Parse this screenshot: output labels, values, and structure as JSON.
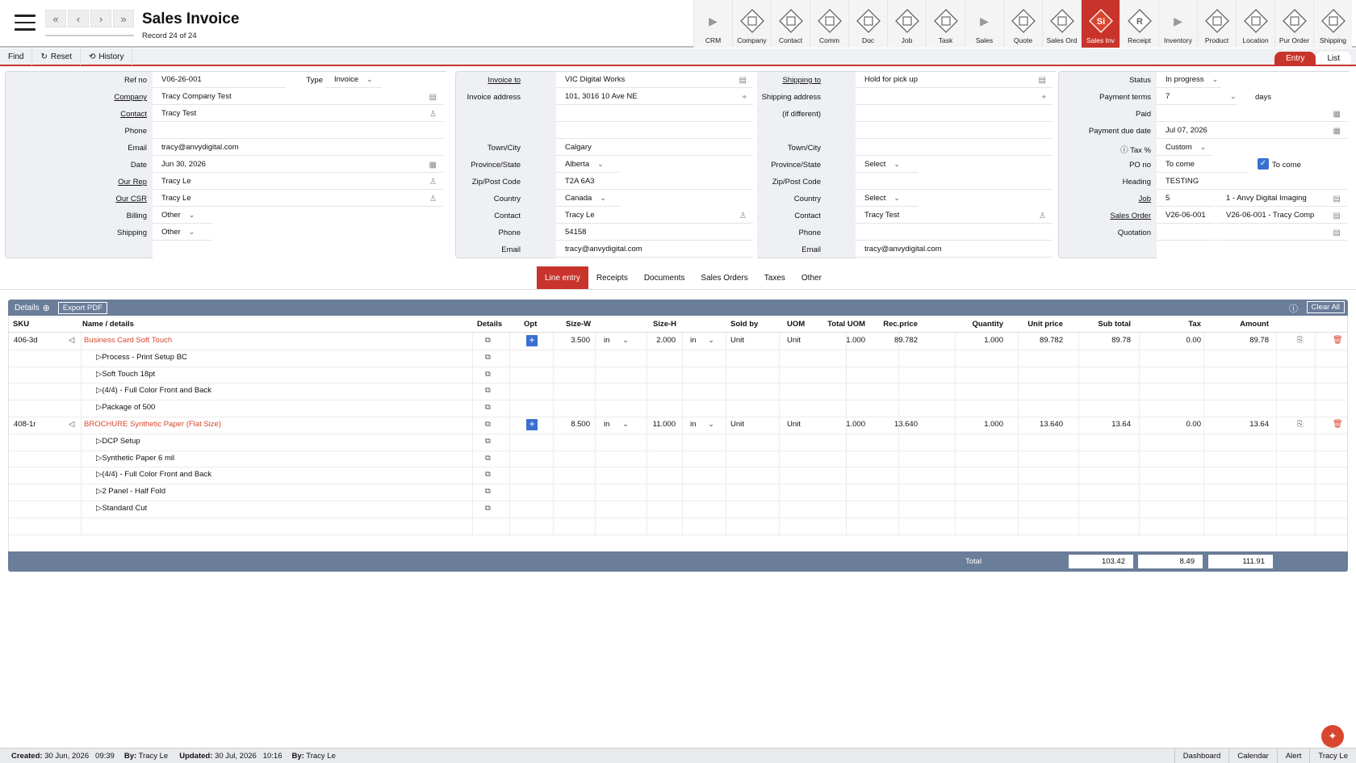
{
  "header": {
    "title": "Sales Invoice",
    "record_info": "Record 24 of 24",
    "nav": [
      "«",
      "‹",
      "›",
      "»"
    ]
  },
  "modules": [
    {
      "label": "CRM",
      "kind": "arrow"
    },
    {
      "label": "Company",
      "kind": "icon"
    },
    {
      "label": "Contact",
      "kind": "icon"
    },
    {
      "label": "Comm",
      "kind": "icon"
    },
    {
      "label": "Doc",
      "kind": "icon"
    },
    {
      "label": "Job",
      "kind": "icon"
    },
    {
      "label": "Task",
      "kind": "icon"
    },
    {
      "label": "Sales",
      "kind": "arrow"
    },
    {
      "label": "Quote",
      "kind": "icon"
    },
    {
      "label": "Sales Ord",
      "kind": "icon"
    },
    {
      "label": "Sales Inv",
      "kind": "icon",
      "active": true,
      "badge": "Si"
    },
    {
      "label": "Receipt",
      "kind": "icon",
      "badge": "R"
    },
    {
      "label": "Inventory",
      "kind": "arrow"
    },
    {
      "label": "Product",
      "kind": "icon"
    },
    {
      "label": "Location",
      "kind": "icon"
    },
    {
      "label": "Pur Order",
      "kind": "icon"
    },
    {
      "label": "Shipping",
      "kind": "icon"
    }
  ],
  "toolbar": {
    "find": "Find",
    "reset": "Reset",
    "history": "History",
    "entry": "Entry",
    "list": "List"
  },
  "left_panel": {
    "refno_label": "Ref no",
    "refno": "V06-26-001",
    "type_label": "Type",
    "type": "Invoice",
    "company_label": "Company",
    "company": "Tracy Company Test",
    "contact_label": "Contact",
    "contact": "Tracy Test",
    "phone_label": "Phone",
    "phone": "",
    "email_label": "Email",
    "email": "tracy@anvydigital.com",
    "date_label": "Date",
    "date": "Jun 30, 2026",
    "ourrep_label": "Our Rep",
    "ourrep": "Tracy Le",
    "ourcsr_label": "Our CSR",
    "ourcsr": "Tracy Le",
    "billing_label": "Billing",
    "billing": "Other",
    "shipping_label": "Shipping",
    "shipping": "Other"
  },
  "invoice_panel": {
    "to_label": "Invoice to",
    "to": "VIC Digital Works",
    "addr_label": "Invoice address",
    "addr": "101, 3016 10 Ave NE",
    "town_label": "Town/City",
    "town": "Calgary",
    "prov_label": "Province/State",
    "prov": "Alberta",
    "zip_label": "Zip/Post Code",
    "zip": "T2A 6A3",
    "country_label": "Country",
    "country": "Canada",
    "contact_label": "Contact",
    "contact": "Tracy Le",
    "phone_label": "Phone",
    "phone": "54158",
    "email_label": "Email",
    "email": "tracy@anvydigital.com"
  },
  "shipping_panel": {
    "to_label": "Shipping to",
    "to": "Hold for pick up",
    "addr_label": "Shipping address",
    "addr_label2": "(if different)",
    "town_label": "Town/City",
    "prov_label": "Province/State",
    "prov": "Select",
    "zip_label": "Zip/Post Code",
    "country_label": "Country",
    "country": "Select",
    "contact_label": "Contact",
    "contact": "Tracy Test",
    "phone_label": "Phone",
    "email_label": "Email",
    "email": "tracy@anvydigital.com"
  },
  "status_panel": {
    "status_label": "Status",
    "status": "In progress",
    "terms_label": "Payment terms",
    "terms": "7",
    "days": "days",
    "paid_label": "Paid",
    "due_label": "Payment due date",
    "due": "Jul 07, 2026",
    "tax_label": "Tax %",
    "tax": "Custom",
    "po_label": "PO no",
    "po": "To come",
    "tocome": "To come",
    "heading_label": "Heading",
    "heading": "TESTING",
    "job_label": "Job",
    "job": "5",
    "job_desc": "1 - Anvy Digital Imaging",
    "so_label": "Sales Order",
    "so": "V26-06-001",
    "so_desc": "V26-06-001 - Tracy Comp",
    "quote_label": "Quotation"
  },
  "tabs": [
    "Line entry",
    "Receipts",
    "Documents",
    "Sales Orders",
    "Taxes",
    "Other"
  ],
  "details": {
    "title": "Details",
    "export": "Export PDF",
    "clear": "Clear All",
    "columns": [
      "SKU",
      "Name / details",
      "Details",
      "Opt",
      "Size-W",
      "Size-H",
      "Sold by",
      "UOM",
      "Total UOM",
      "Rec.price",
      "Quantity",
      "Unit price",
      "Sub total",
      "Tax",
      "Amount"
    ],
    "rows": [
      {
        "sku": "406-3d",
        "name": "Business Card Soft Touch",
        "w": "3.500",
        "wu": "in",
        "h": "2.000",
        "hu": "in",
        "soldby": "Unit",
        "uom": "Unit",
        "tuom": "1.000",
        "rec": "89.782",
        "qty": "1.000",
        "unit": "89.782",
        "sub": "89.78",
        "tax": "0.00",
        "amt": "89.78",
        "children": [
          "Process - Print Setup BC",
          "Soft Touch 18pt",
          "(4/4) - Full Color Front and Back",
          "Package of 500"
        ]
      },
      {
        "sku": "408-1r",
        "name": "BROCHURE Synthetic Paper (Flat Size)",
        "w": "8.500",
        "wu": "in",
        "h": "11.000",
        "hu": "in",
        "soldby": "Unit",
        "uom": "Unit",
        "tuom": "1.000",
        "rec": "13.640",
        "qty": "1.000",
        "unit": "13.640",
        "sub": "13.64",
        "tax": "0.00",
        "amt": "13.64",
        "children": [
          "DCP Setup",
          "Synthetic Paper 6 mil",
          "(4/4) - Full Color Front and Back",
          "2 Panel - Half Fold",
          "Standard Cut"
        ]
      }
    ],
    "total_label": "Total",
    "total_sub": "103.42",
    "total_tax": "8.49",
    "total_amt": "111.91"
  },
  "statusbar": {
    "created_label": "Created:",
    "created": "30 Jun, 2026",
    "created_time": "09:39",
    "by_label": "By:",
    "by": "Tracy Le",
    "updated_label": "Updated:",
    "updated": "30 Jul, 2026",
    "updated_time": "10:16",
    "by2": "Tracy Le",
    "links": [
      "Dashboard",
      "Calendar",
      "Alert",
      "Tracy Le"
    ]
  }
}
